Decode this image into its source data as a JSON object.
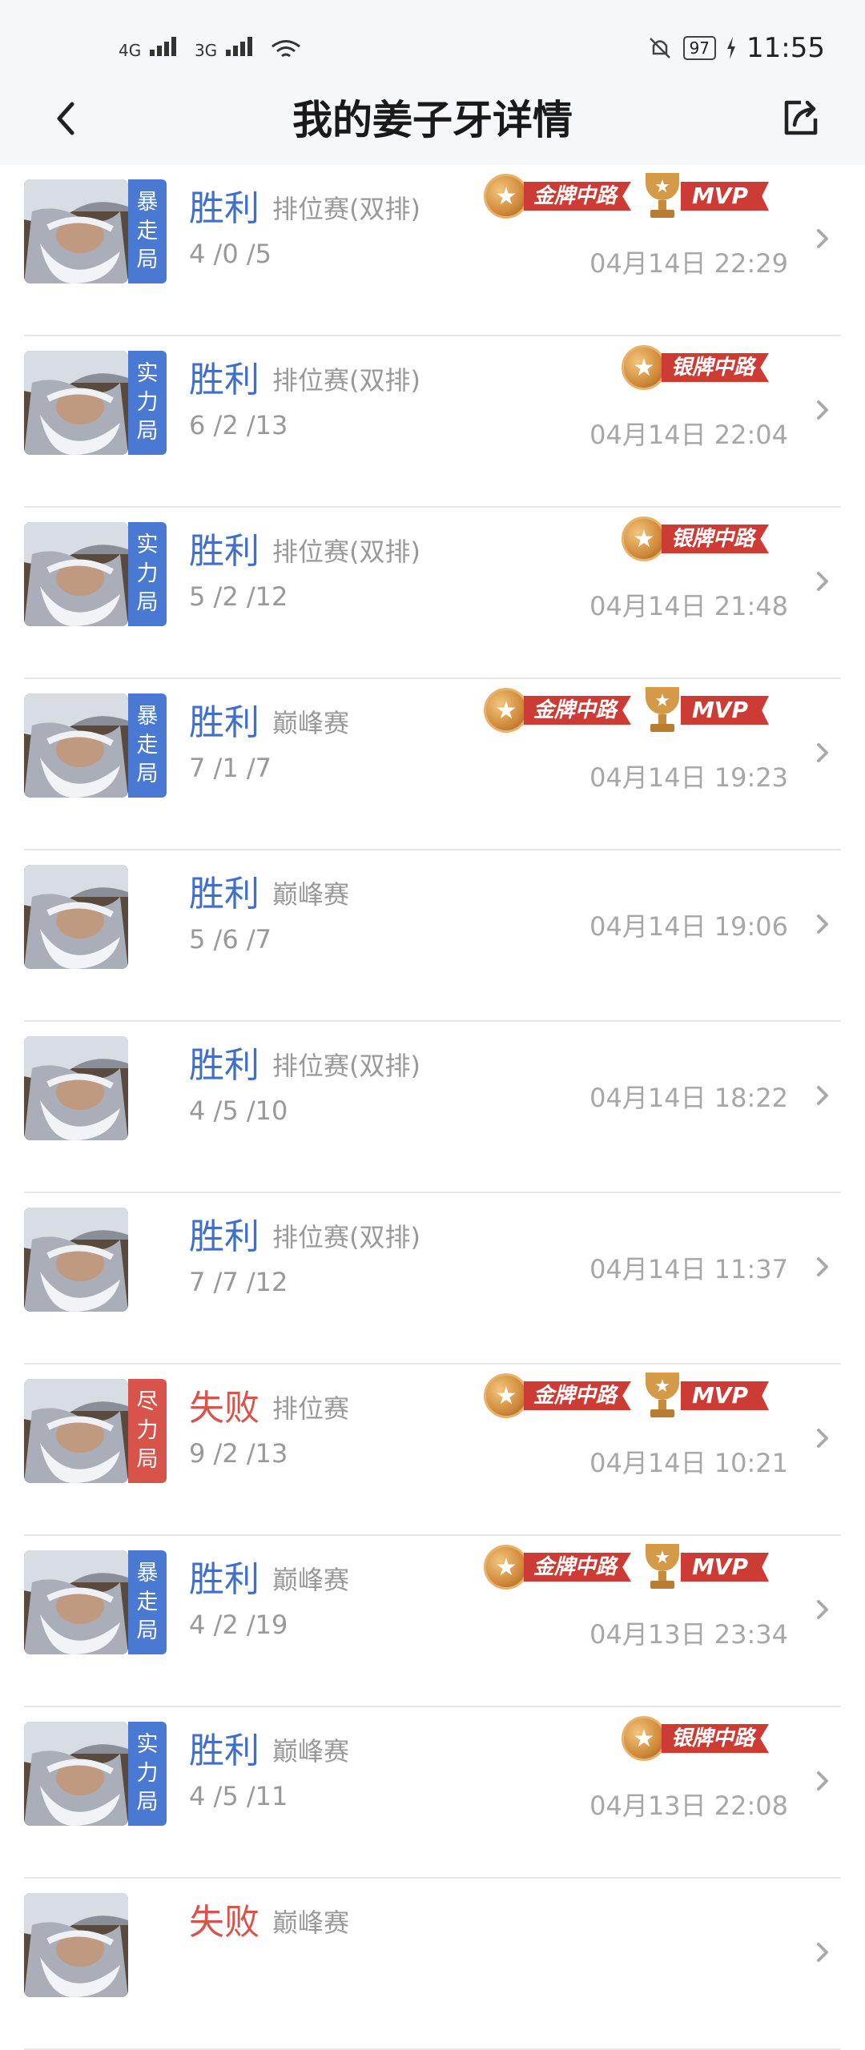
{
  "status_bar": {
    "net1": "4G",
    "net2": "3G",
    "battery": "97",
    "time": "11:55"
  },
  "header": {
    "title": "我的姜子牙详情"
  },
  "icons": {
    "back": "back-arrow-icon",
    "share": "share-icon",
    "chevron": "chevron-right-icon"
  },
  "matches": [
    {
      "tag": "暴走局",
      "tag_color": "blue",
      "result": "胜利",
      "result_type": "win",
      "mode": "排位赛(双排)",
      "kda": "4 /0 /5",
      "date": "04月14日 22:29",
      "badges": [
        "金牌中路",
        "MVP"
      ]
    },
    {
      "tag": "实力局",
      "tag_color": "blue",
      "result": "胜利",
      "result_type": "win",
      "mode": "排位赛(双排)",
      "kda": "6 /2 /13",
      "date": "04月14日 22:04",
      "badges": [
        "银牌中路"
      ]
    },
    {
      "tag": "实力局",
      "tag_color": "blue",
      "result": "胜利",
      "result_type": "win",
      "mode": "排位赛(双排)",
      "kda": "5 /2 /12",
      "date": "04月14日 21:48",
      "badges": [
        "银牌中路"
      ]
    },
    {
      "tag": "暴走局",
      "tag_color": "blue",
      "result": "胜利",
      "result_type": "win",
      "mode": "巅峰赛",
      "kda": "7 /1 /7",
      "date": "04月14日 19:23",
      "badges": [
        "金牌中路",
        "MVP"
      ]
    },
    {
      "tag": "",
      "tag_color": "",
      "result": "胜利",
      "result_type": "win",
      "mode": "巅峰赛",
      "kda": "5 /6 /7",
      "date": "04月14日 19:06",
      "badges": []
    },
    {
      "tag": "",
      "tag_color": "",
      "result": "胜利",
      "result_type": "win",
      "mode": "排位赛(双排)",
      "kda": "4 /5 /10",
      "date": "04月14日 18:22",
      "badges": []
    },
    {
      "tag": "",
      "tag_color": "",
      "result": "胜利",
      "result_type": "win",
      "mode": "排位赛(双排)",
      "kda": "7 /7 /12",
      "date": "04月14日 11:37",
      "badges": []
    },
    {
      "tag": "尽力局",
      "tag_color": "red",
      "result": "失败",
      "result_type": "lose",
      "mode": "排位赛",
      "kda": "9 /2 /13",
      "date": "04月14日 10:21",
      "badges": [
        "金牌中路",
        "MVP"
      ]
    },
    {
      "tag": "暴走局",
      "tag_color": "blue",
      "result": "胜利",
      "result_type": "win",
      "mode": "巅峰赛",
      "kda": "4 /2 /19",
      "date": "04月13日 23:34",
      "badges": [
        "金牌中路",
        "MVP"
      ]
    },
    {
      "tag": "实力局",
      "tag_color": "blue",
      "result": "胜利",
      "result_type": "win",
      "mode": "巅峰赛",
      "kda": "4 /5 /11",
      "date": "04月13日 22:08",
      "badges": [
        "银牌中路"
      ]
    },
    {
      "tag": "",
      "tag_color": "",
      "result": "失败",
      "result_type": "lose",
      "mode": "巅峰赛",
      "kda": "",
      "date": "",
      "badges": []
    }
  ]
}
